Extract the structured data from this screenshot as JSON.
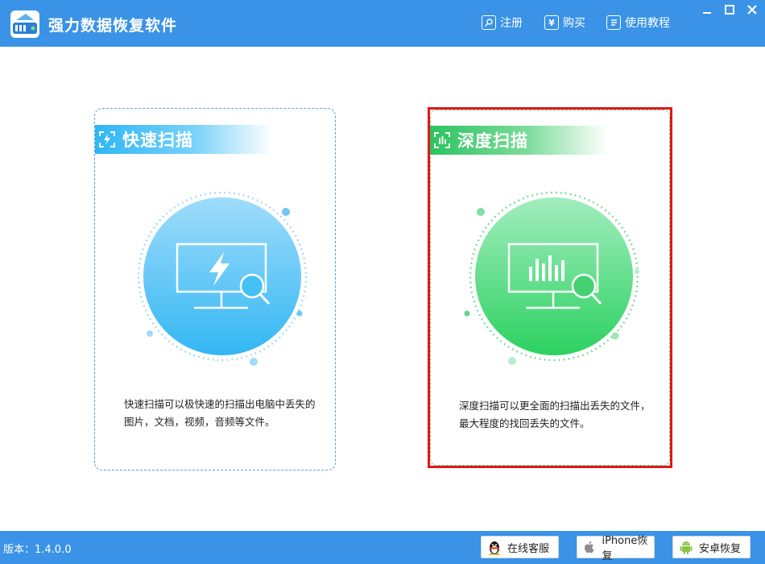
{
  "window": {
    "title": "强力数据恢复软件",
    "links": [
      {
        "id": "register",
        "label": "注册",
        "icon": "key-icon"
      },
      {
        "id": "buy",
        "label": "购买",
        "icon": "yen-icon"
      },
      {
        "id": "tutorial",
        "label": "使用教程",
        "icon": "document-icon"
      }
    ],
    "controls": [
      "minimize",
      "maximize",
      "close"
    ]
  },
  "panels": {
    "quick": {
      "title": "快速扫描",
      "description": "快速扫描可以极快速的扫描出电脑中丢失的图片，文档，视频，音频等文件。",
      "color": "#2fb6f5"
    },
    "deep": {
      "title": "深度扫描",
      "description": "深度扫描可以更全面的扫描出丢失的文件，最大程度的找回丢失的文件。",
      "color": "#2cc35f",
      "selected": true,
      "selection_color": "#e01818"
    }
  },
  "statusbar": {
    "version": "版本：1.4.0.0",
    "buttons": [
      {
        "id": "support",
        "label": "在线客服",
        "icon": "penguin-icon"
      },
      {
        "id": "iphone",
        "label": "iPhone恢复",
        "icon": "apple-icon"
      },
      {
        "id": "android",
        "label": "安卓恢复",
        "icon": "android-icon"
      }
    ]
  },
  "colors": {
    "brand": "#3a93e6",
    "quick_accent": "#2fb6f5",
    "deep_accent": "#2cc35f"
  }
}
